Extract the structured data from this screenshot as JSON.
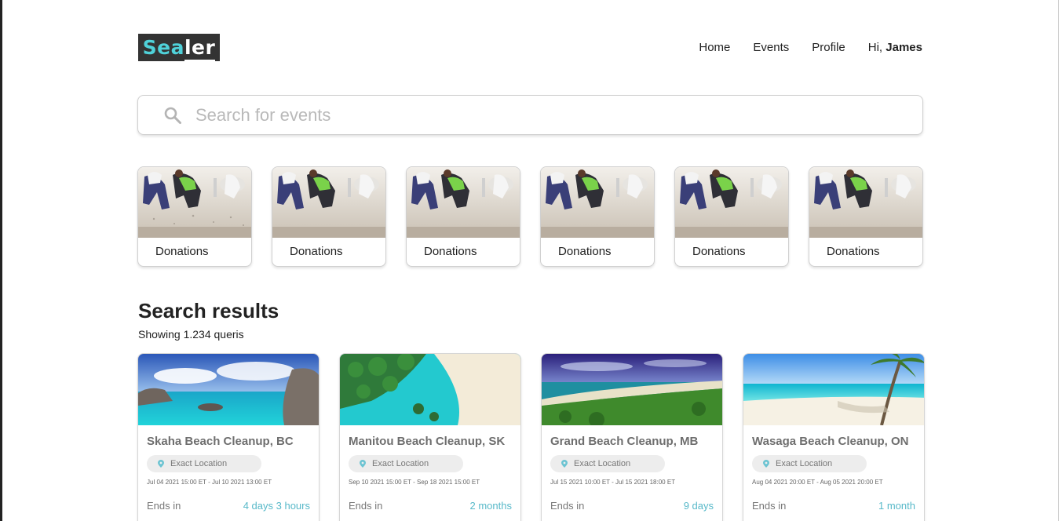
{
  "brand": {
    "logo_part1": "Sea",
    "logo_part2": "ler",
    "accent_color": "#4fd1d9",
    "bg_color": "#333333"
  },
  "nav": {
    "items": [
      {
        "label": "Home"
      },
      {
        "label": "Events"
      },
      {
        "label": "Profile"
      }
    ],
    "greeting": "Hi,",
    "user_name": "James"
  },
  "search": {
    "placeholder": "Search for events",
    "value": "",
    "icon": "search-icon"
  },
  "categories": [
    {
      "label": "Donations"
    },
    {
      "label": "Donations"
    },
    {
      "label": "Donations"
    },
    {
      "label": "Donations"
    },
    {
      "label": "Donations"
    },
    {
      "label": "Donations"
    }
  ],
  "results": {
    "title": "Search results",
    "count_text": "Showing 1.234 queris",
    "events": [
      {
        "title": "Skaha Beach Cleanup, BC",
        "location": "Exact Location",
        "dates": "Jul 04 2021 15:00 ET - Jul 10 2021 13:00 ET",
        "ends_label": "Ends in",
        "ends_value": "4 days 3 hours"
      },
      {
        "title": "Manitou Beach Cleanup, SK",
        "location": "Exact Location",
        "dates": "Sep 10 2021 15:00 ET - Sep 18 2021 15:00 ET",
        "ends_label": "Ends in",
        "ends_value": "2 months"
      },
      {
        "title": "Grand Beach Cleanup, MB",
        "location": "Exact Location",
        "dates": "Jul 15 2021 10:00 ET - Jul 15 2021 18:00 ET",
        "ends_label": "Ends in",
        "ends_value": "9 days"
      },
      {
        "title": "Wasaga Beach Cleanup, ON",
        "location": "Exact Location",
        "dates": "Aug 04 2021 20:00 ET - Aug 05 2021 20:00 ET",
        "ends_label": "Ends in",
        "ends_value": "1 month"
      }
    ]
  },
  "colors": {
    "accent": "#58b9c9",
    "muted_text": "#6e6e6e",
    "pill_bg": "#ededed"
  }
}
